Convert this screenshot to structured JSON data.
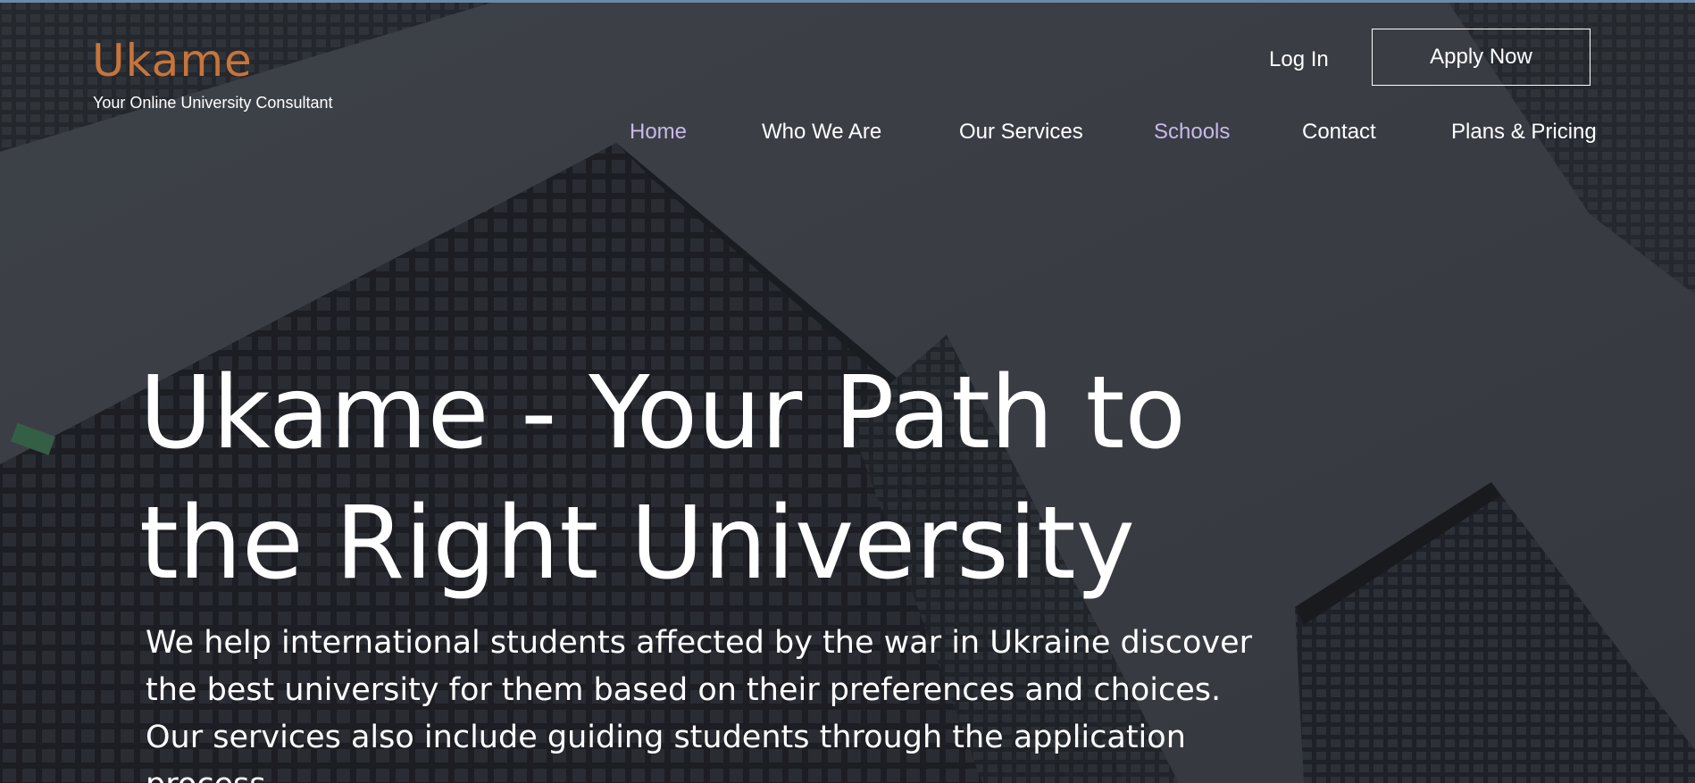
{
  "brand": {
    "logo": "Ukame",
    "tagline": "Your Online University Consultant",
    "logo_color": "#c8743a"
  },
  "header": {
    "login_label": "Log In",
    "apply_label": "Apply Now"
  },
  "nav": {
    "items": [
      {
        "label": "Home",
        "active": true
      },
      {
        "label": "Who We Are",
        "active": false
      },
      {
        "label": "Our Services",
        "active": false
      },
      {
        "label": "Schools",
        "active": true
      },
      {
        "label": "Contact",
        "active": false
      },
      {
        "label": "Plans & Pricing",
        "active": false
      }
    ],
    "active_color": "#c9b8ea"
  },
  "hero": {
    "headline_line1": "Ukame - Your Path to",
    "headline_line2": "the Right University",
    "subtext_line1": "We help international students affected by the war in Ukraine discover",
    "subtext_line2": "the best university for them based on their preferences and choices.",
    "subtext_line3": "Our services also include guiding students through the application",
    "subtext_line4": "process."
  }
}
